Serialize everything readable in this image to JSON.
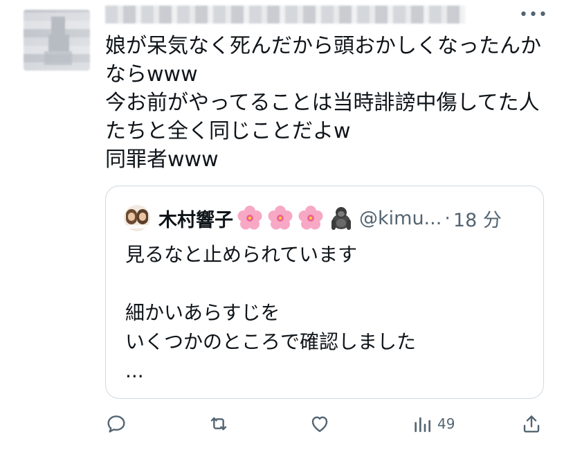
{
  "post": {
    "text_lines": [
      "娘が呆気なく死んだから頭おかしくなったんか",
      "ならwww",
      "今お前がやってることは当時誹謗中傷してた人",
      "たちと全く同じことだよw",
      "同罪者www"
    ]
  },
  "quoted": {
    "name": "木村響子",
    "name_emoji": [
      "cherry-blossom",
      "cherry-blossom",
      "cherry-blossom",
      "gorilla"
    ],
    "handle": "@kimu...",
    "separator": "·",
    "time": "18 分",
    "body_lines": [
      "見るなと止められています",
      "",
      "細かいあらすじを",
      "いくつかのところで確認しました",
      "..."
    ]
  },
  "actions": {
    "reply_icon": "reply-icon",
    "retweet_icon": "retweet-icon",
    "like_icon": "heart-icon",
    "views_icon": "views-icon",
    "views_count": "49",
    "share_icon": "share-icon"
  },
  "colors": {
    "text": "#0f1419",
    "secondary": "#536471",
    "border": "#cfd9de",
    "blossom": "#f7a8c4"
  }
}
